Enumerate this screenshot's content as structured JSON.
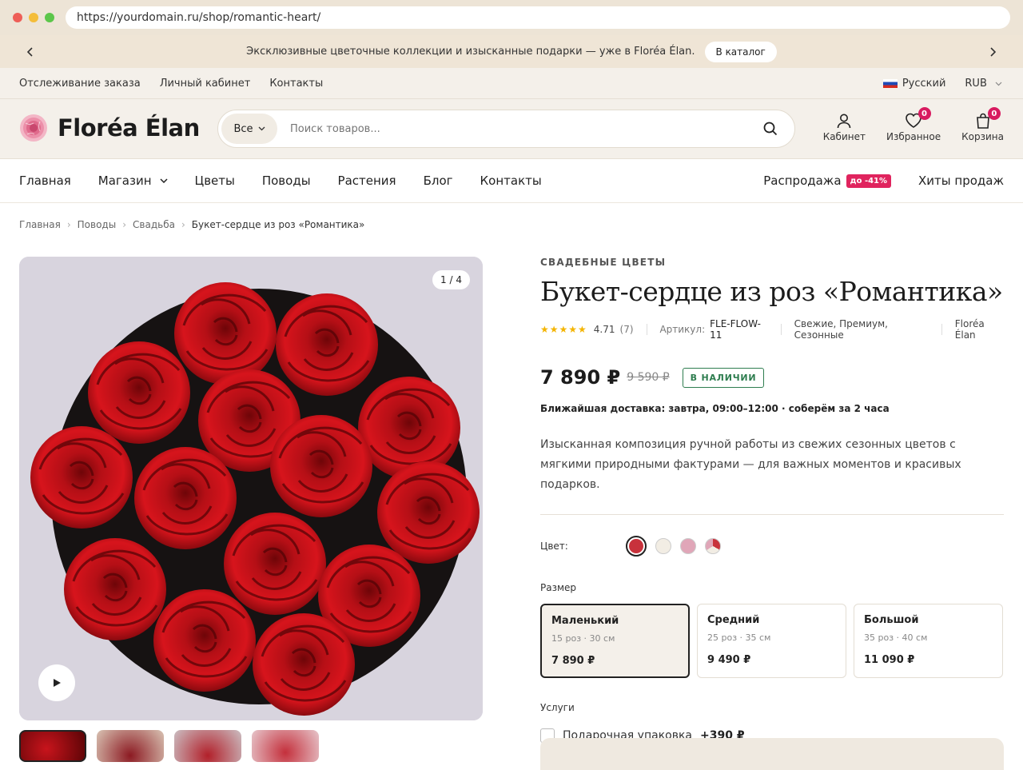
{
  "browser": {
    "url": "https://yourdomain.ru/shop/romantic-heart/"
  },
  "promo": {
    "text": "Эксклюзивные цветочные коллекции и изысканные подарки — уже в Floréa Élan.",
    "button": "В каталог"
  },
  "utility": {
    "links": [
      "Отслеживание заказа",
      "Личный кабинет",
      "Контакты"
    ],
    "language": "Русский",
    "currency": "RUB"
  },
  "header": {
    "logo": "Floréa Élan",
    "category": "Все",
    "search_placeholder": "Поиск товаров...",
    "account": "Кабинет",
    "wishlist": "Избранное",
    "wishlist_count": "0",
    "cart": "Корзина",
    "cart_count": "0"
  },
  "nav": {
    "items": [
      "Главная",
      "Магазин",
      "Цветы",
      "Поводы",
      "Растения",
      "Блог",
      "Контакты"
    ],
    "sale": "Распродажа",
    "sale_badge": "до -41%",
    "hits": "Хиты продаж"
  },
  "breadcrumb": [
    "Главная",
    "Поводы",
    "Свадьба",
    "Букет-сердце из роз «Романтика»"
  ],
  "gallery": {
    "counter": "1 / 4"
  },
  "product": {
    "eyebrow": "СВАДЕБНЫЕ ЦВЕТЫ",
    "title": "Букет-сердце из роз «Романтика»",
    "rating": "4.71",
    "reviews": "(7)",
    "sku_label": "Артикул:",
    "sku": "FLE-FLOW-11",
    "tags": "Свежие, Премиум, Сезонные",
    "brand": "Floréa Élan",
    "price": "7 890 ₽",
    "old_price": "9 590 ₽",
    "stock": "В НАЛИЧИИ",
    "delivery": "Ближайшая доставка: завтра, 09:00–12:00 · соберём за 2 часа",
    "description": "Изысканная композиция ручной работы из свежих сезонных цветов с мягкими природными фактурами — для важных моментов и красивых подарков.",
    "color_label": "Цвет:",
    "colors": [
      "#c8323c",
      "#f2ede4",
      "#e0a6b8",
      "#mixed"
    ],
    "size_label": "Размер",
    "sizes": [
      {
        "name": "Маленький",
        "detail": "15 роз · 30 см",
        "price": "7 890 ₽"
      },
      {
        "name": "Средний",
        "detail": "25 роз · 35 см",
        "price": "9 490 ₽"
      },
      {
        "name": "Большой",
        "detail": "35 роз · 40 см",
        "price": "11 090 ₽"
      }
    ],
    "services_label": "Услуги",
    "service": {
      "name": "Подарочная упаковка",
      "price": "+390 ₽"
    }
  }
}
